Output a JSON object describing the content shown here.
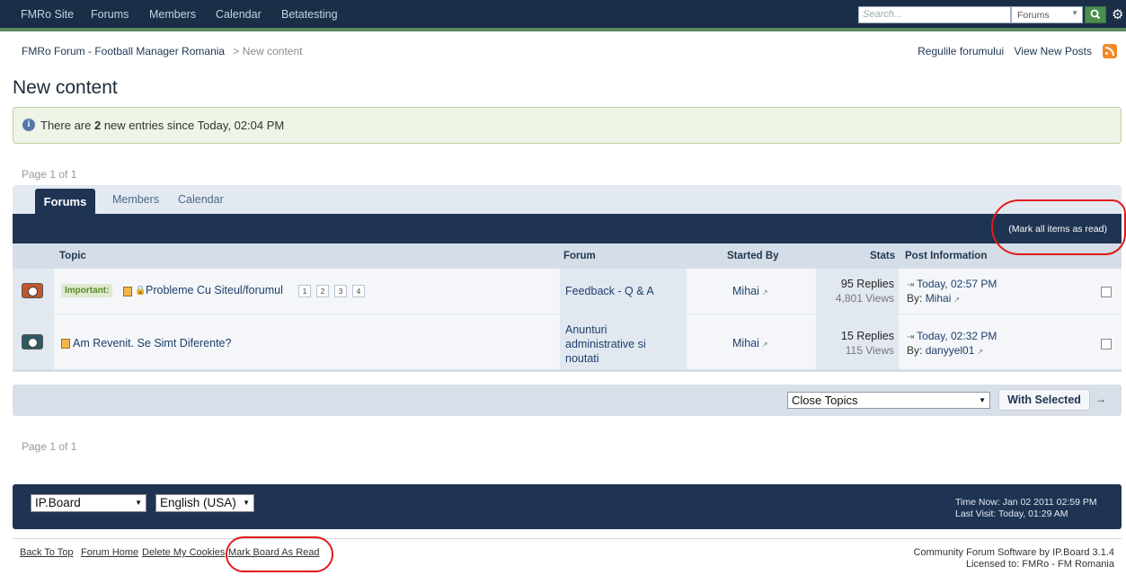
{
  "topnav": {
    "items": [
      "FMRo Site",
      "Forums",
      "Members",
      "Calendar",
      "Betatesting"
    ],
    "search_placeholder": "Search...",
    "search_scope": "Forums"
  },
  "breadcrumb": {
    "home": "FMRo Forum - Football Manager Romania",
    "sep": ">",
    "current": "New content"
  },
  "toplinks": [
    "Regulile forumului",
    "View New Posts"
  ],
  "page_title": "New content",
  "message": {
    "pre": "There are ",
    "count": "2",
    "post": " new entries since Today, 02:04 PM"
  },
  "pagination_top": "Page 1 of 1",
  "pagination_bottom": "Page 1 of 1",
  "tabs": [
    "Forums",
    "Members",
    "Calendar"
  ],
  "mark_all": "(Mark all items as read)",
  "columns": {
    "topic": "Topic",
    "forum": "Forum",
    "started_by": "Started By",
    "stats": "Stats",
    "post_info": "Post Information"
  },
  "rows": [
    {
      "badge": "Important:",
      "title": "Probleme Cu Siteul/forumul",
      "pages": [
        "1",
        "2",
        "3",
        "4"
      ],
      "forum": "Feedback - Q & A",
      "starter": "Mihai",
      "replies": "95 Replies",
      "views": "4,801 Views",
      "last_time": "Today, 02:57 PM",
      "by_label": "By:",
      "last_by": "Mihai"
    },
    {
      "badge": "",
      "title": "Am Revenit. Se Simt Diferente?",
      "pages": [],
      "forum_lines": [
        "Anunturi",
        "administrative si",
        "noutati"
      ],
      "starter": "Mihai",
      "replies": "15 Replies",
      "views": "115 Views",
      "last_time": "Today, 02:32 PM",
      "by_label": "By:",
      "last_by": "danyyel01"
    }
  ],
  "moderation": {
    "action": "Close Topics",
    "button": "With Selected"
  },
  "footer": {
    "skin": "IP.Board",
    "language": "English (USA)",
    "time_now": "Time Now: Jan 02 2011 02:59 PM",
    "last_visit": "Last Visit: Today, 01:29 AM",
    "links": [
      "Back To Top",
      "Forum Home",
      "Delete My Cookies",
      "Mark Board As Read"
    ],
    "copyright_1": "Community Forum Software by IP.Board 3.1.4",
    "copyright_2": "Licensed to: FMRo - FM Romania"
  },
  "colors": {
    "header": "#1a2e47",
    "accent": "#5b8a5e",
    "annotation": "#e21b1b"
  }
}
